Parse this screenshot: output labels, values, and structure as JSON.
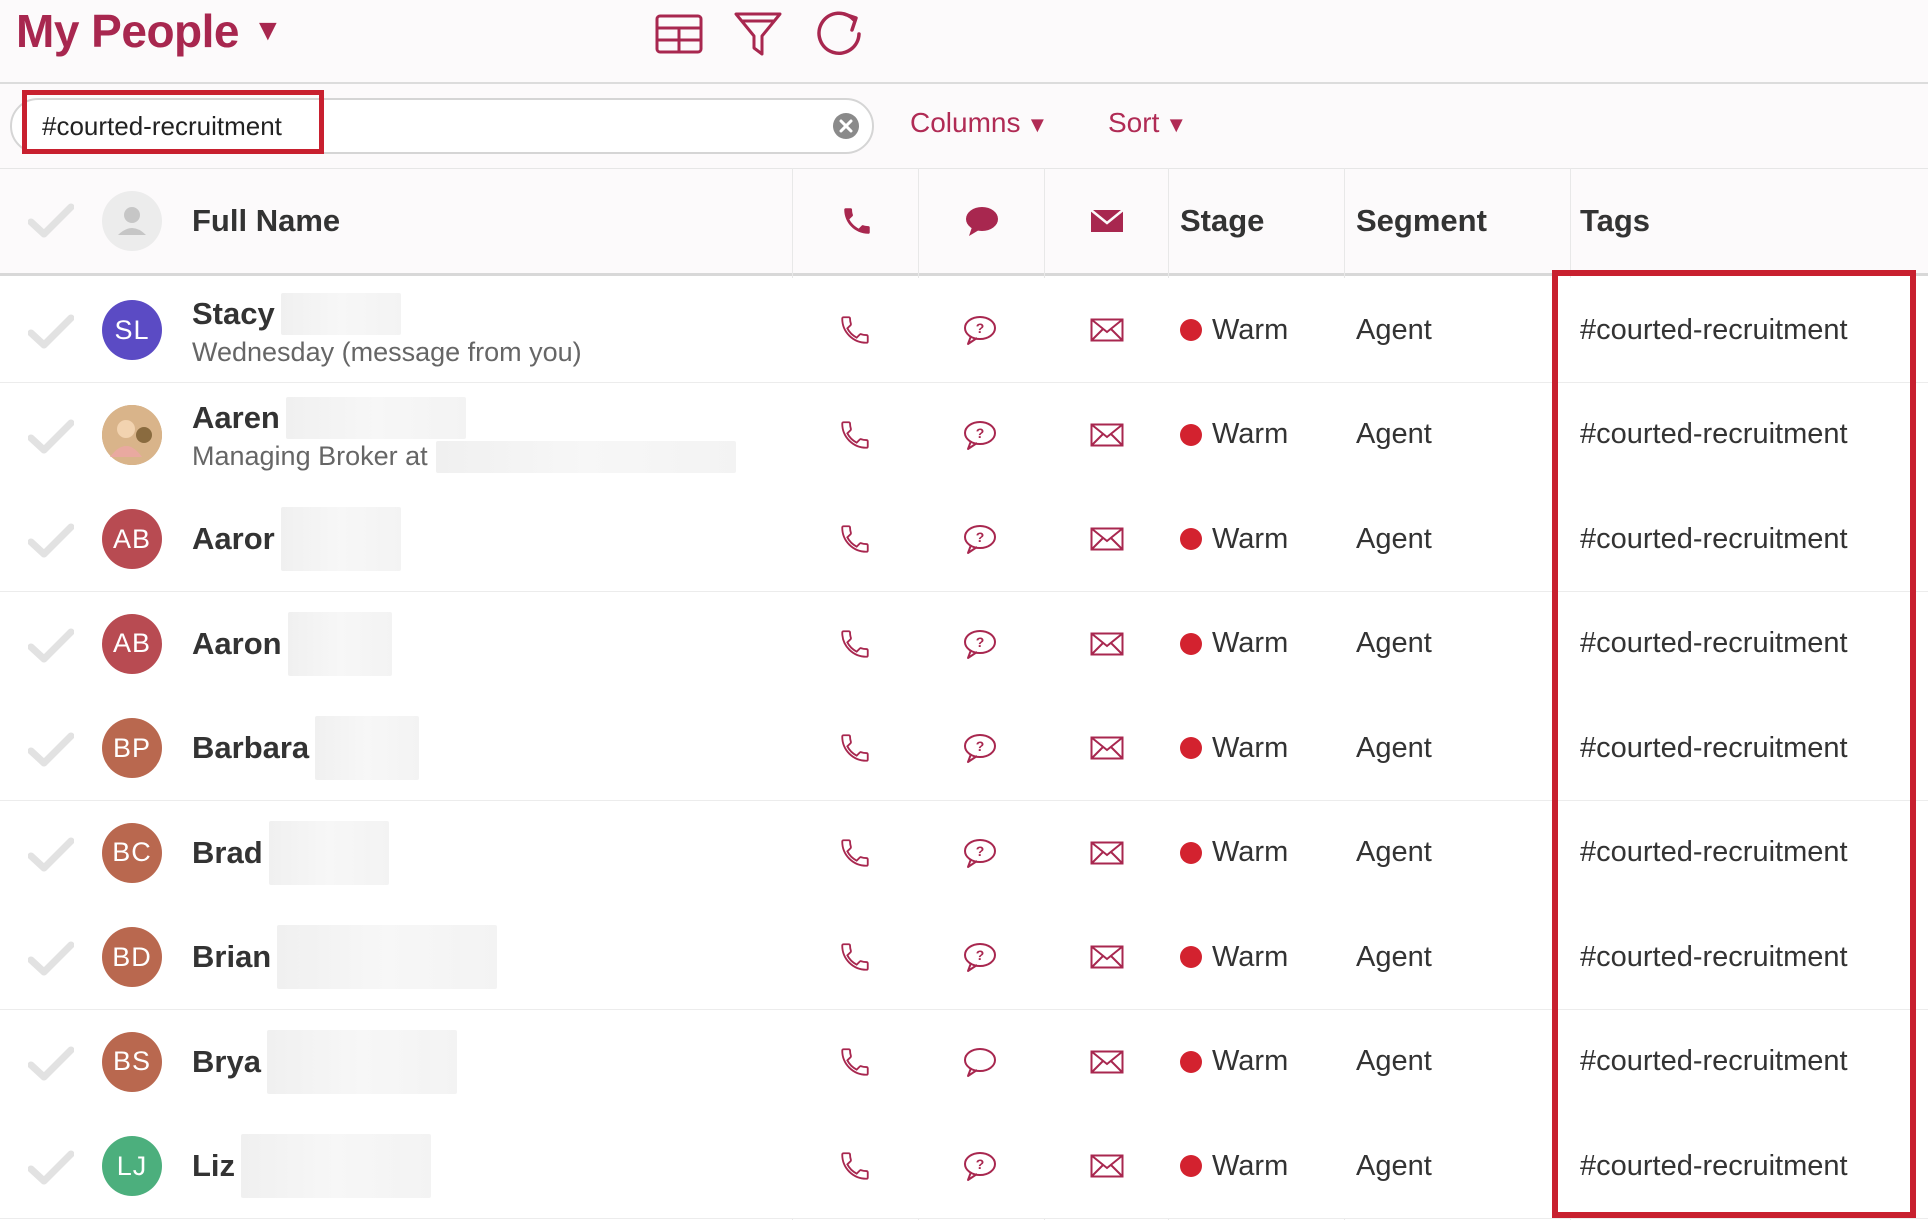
{
  "header": {
    "title": "My People",
    "title_caret": "▼",
    "icons": [
      "table-view-icon",
      "filter-icon",
      "refresh-icon"
    ]
  },
  "search": {
    "value": "#courted-recruitment",
    "placeholder": ""
  },
  "toolbar": {
    "columns_label": "Columns",
    "sort_label": "Sort",
    "caret": "▼"
  },
  "columns": {
    "full_name": "Full Name",
    "stage": "Stage",
    "segment": "Segment",
    "tags": "Tags"
  },
  "colors": {
    "accent": "#a8274f",
    "stage_warm": "#d3222f",
    "highlight": "#c8202f"
  },
  "rows": [
    {
      "name": "Stacy",
      "initials": "SL",
      "avatar_color": "#5b4bc4",
      "subtitle": "Wednesday (message from you)",
      "stage": "Warm",
      "segment": "Agent",
      "tag": "#courted-recruitment",
      "text_icon": "text-unread-icon"
    },
    {
      "name": "Aaren",
      "initials": "",
      "avatar_color": "#c9a06e",
      "subtitle": "Managing Broker at",
      "stage": "Warm",
      "segment": "Agent",
      "tag": "#courted-recruitment",
      "text_icon": "text-unread-icon"
    },
    {
      "name": "Aaror",
      "initials": "AB",
      "avatar_color": "#b84b52",
      "subtitle": "",
      "stage": "Warm",
      "segment": "Agent",
      "tag": "#courted-recruitment",
      "text_icon": "text-unread-icon"
    },
    {
      "name": "Aaron",
      "initials": "AB",
      "avatar_color": "#b84b52",
      "subtitle": "",
      "stage": "Warm",
      "segment": "Agent",
      "tag": "#courted-recruitment",
      "text_icon": "text-unread-icon"
    },
    {
      "name": "Barbara",
      "initials": "BP",
      "avatar_color": "#b9684f",
      "subtitle": "",
      "stage": "Warm",
      "segment": "Agent",
      "tag": "#courted-recruitment",
      "text_icon": "text-unread-icon"
    },
    {
      "name": "Brad",
      "initials": "BC",
      "avatar_color": "#b9684f",
      "subtitle": "",
      "stage": "Warm",
      "segment": "Agent",
      "tag": "#courted-recruitment",
      "text_icon": "text-unread-icon"
    },
    {
      "name": "Brian",
      "initials": "BD",
      "avatar_color": "#b9684f",
      "subtitle": "",
      "stage": "Warm",
      "segment": "Agent",
      "tag": "#courted-recruitment",
      "text_icon": "text-unread-icon"
    },
    {
      "name": "Brya",
      "initials": "BS",
      "avatar_color": "#b9684f",
      "subtitle": "",
      "stage": "Warm",
      "segment": "Agent",
      "tag": "#courted-recruitment",
      "text_icon": "text-icon"
    },
    {
      "name": "Liz",
      "initials": "LJ",
      "avatar_color": "#4caf7d",
      "subtitle": "",
      "stage": "Warm",
      "segment": "Agent",
      "tag": "#courted-recruitment",
      "text_icon": "text-unread-icon"
    }
  ]
}
